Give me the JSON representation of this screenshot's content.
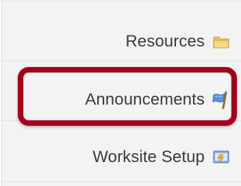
{
  "sidebar": {
    "items": [
      {
        "label": "Resources",
        "icon": "folder-icon"
      },
      {
        "label": "Announcements",
        "icon": "flag-icon"
      },
      {
        "label": "Worksite Setup",
        "icon": "worksite-setup-icon"
      }
    ]
  },
  "colors": {
    "sidebar_bg": "#f3f3f3",
    "text": "#3a3a3a",
    "highlight_ring": "#a3001c"
  }
}
